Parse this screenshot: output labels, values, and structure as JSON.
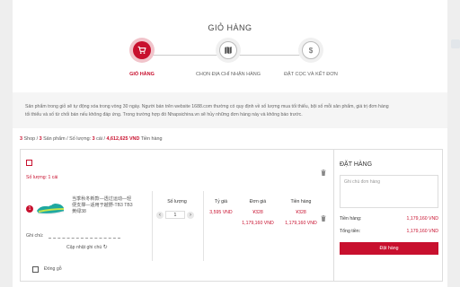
{
  "page_title": "GIỎ HÀNG",
  "steps": [
    {
      "label": "GIỎ HÀNG",
      "icon": "cart-icon",
      "active": true
    },
    {
      "label": "CHỌN ĐỊA CHỈ NHẬN HÀNG",
      "icon": "map-icon",
      "active": false
    },
    {
      "label": "ĐẶT CỌC VÀ KẾT ĐƠN",
      "icon": "dollar-icon",
      "active": false
    }
  ],
  "notice": {
    "line1": "Sản phẩm trong giỏ sẽ tự động xóa trong vòng 30 ngày. Người bán trên website 1688.com thường có quy định về số lượng mua tối thiểu, bội số mỗi sản phẩm, giá trị đơn hàng",
    "line2": "tối thiểu và số từ chối bán nếu không đáp ứng. Trong trường hợp đó Nhapsichina.vn sẽ hủy những đơn hàng này và không báo trước."
  },
  "summary": {
    "shops_count": "3",
    "shops_label": " Shop / ",
    "products_count": "3",
    "products_label": " Sản phẩm / Số lượng: ",
    "qty": "3",
    "qty_label": " cái / ",
    "total": "4,612,625 VND",
    "total_label": " Tiền hàng"
  },
  "shop": {
    "qty_label": "Số lượng: 1 cái"
  },
  "item": {
    "index": "1",
    "name": "当季秋冬新款—透过运动—轻便支撑—适用于越野-TB3 TB3黄绿38",
    "cols": {
      "qty_header": "Số lượng",
      "unit_header": "Tỷ giá",
      "price_header": "Đơn giá",
      "amount_header": "Tiền hàng"
    },
    "qty": "1",
    "rate": "3,595 VND",
    "price_cny": "¥328",
    "price_vnd": "1,179,160 VND",
    "amount_cny": "¥328",
    "amount_vnd": "1,179,160 VND",
    "note_label": "Ghi chú:",
    "update_label": "Cập nhật ghi chú"
  },
  "wood": {
    "label": "Đóng gỗ"
  },
  "order": {
    "title": "ĐẶT HÀNG",
    "note_placeholder": "Ghi chú đơn hàng",
    "goods_label": "Tiền hàng:",
    "goods_value": "1,179,160 VND",
    "total_label": "Tổng tiền:",
    "total_value": "1,179,160 VND",
    "button": "Đặt hàng"
  },
  "colors": {
    "accent": "#c8102e"
  }
}
